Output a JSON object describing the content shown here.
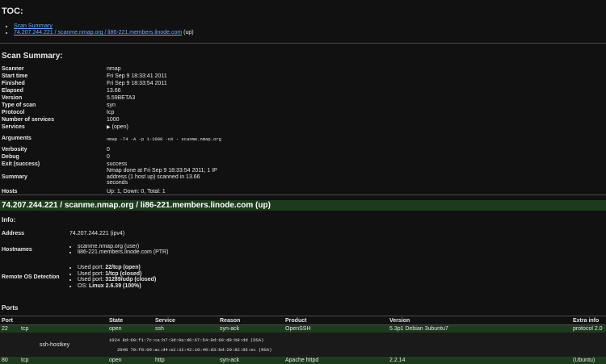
{
  "toc": {
    "title": "TOC:",
    "items": [
      {
        "link": "Scan Summary",
        "suffix": ""
      },
      {
        "link": "74.207.244.221 / scanme.nmap.org / li86-221.members.linode.com",
        "suffix": " (up)"
      }
    ]
  },
  "summary": {
    "title": "Scan Summary:",
    "rows": [
      {
        "label": "Scanner",
        "value": "nmap"
      },
      {
        "label": "Start time",
        "value": "Fri Sep 9 18:33:41 2011"
      },
      {
        "label": "Finished",
        "value": "Fri Sep 9 18:33:54 2011"
      },
      {
        "label": "Elapsed",
        "value": "13.66"
      },
      {
        "label": "Version",
        "value": "5.59BETA3"
      },
      {
        "label": "Type of scan",
        "value": "syn"
      },
      {
        "label": "Protocol",
        "value": "tcp"
      },
      {
        "label": "Number of services",
        "value": "1000"
      },
      {
        "label": "Services",
        "value": "(open)"
      },
      {
        "label": "Arguments",
        "value": "nmap -T4 -A -p 1-1000 -oX - scanme.nmap.org"
      },
      {
        "label": "Verbosity",
        "value": "0"
      },
      {
        "label": "Debug",
        "value": "0"
      },
      {
        "label": "Exit (success)",
        "value": "success"
      },
      {
        "label": "Summary",
        "value": "Nmap done at Fri Sep 9 18:33:54 2011; 1 IP address (1 host up) scanned in 13.66 seconds"
      },
      {
        "label": "Hosts",
        "value": "Up: 1, Down: 0, Total: 1"
      }
    ]
  },
  "host": {
    "heading": "74.207.244.221 / scanme.nmap.org / li86-221.members.linode.com (up)",
    "info_title": "Info:",
    "address_label": "Address",
    "address": "74.207.244.221 (ipv4)",
    "hostnames_label": "Hostnames",
    "hostnames": [
      "scanme.nmap.org (user)",
      "li86-221.members.linode.com (PTR)"
    ],
    "os_label": "Remote OS Detection",
    "os": [
      {
        "prefix": "Used port: ",
        "bold": "22/tcp (open)"
      },
      {
        "prefix": "Used port: ",
        "bold": "1/tcp (closed)"
      },
      {
        "prefix": "Used port: ",
        "bold": "31289/udp (closed)"
      },
      {
        "prefix": "OS: ",
        "bold": "Linux 2.6.39 (100%)"
      }
    ]
  },
  "ports": {
    "title": "Ports",
    "headers": [
      "Port",
      "",
      "State",
      "Service",
      "Reason",
      "Product",
      "Version",
      "Extra info"
    ],
    "rows": [
      {
        "port": "22",
        "proto": "tcp",
        "state": "open",
        "service": "ssh",
        "reason": "syn-ack",
        "product": "OpenSSH",
        "version": "5.3p1 Debian 3ubuntu7",
        "extra": "protocol 2.0"
      },
      {
        "port": "80",
        "proto": "tcp",
        "state": "open",
        "service": "http",
        "reason": "syn-ack",
        "product": "Apache httpd",
        "version": "2.2.14",
        "extra": "(Ubuntu)"
      }
    ],
    "script": {
      "name": "ssh-hostkey",
      "line1": "1024 8d:60:f1:7c:ca:b7:3d:0a:d6:67:54:9d:69:d9:b9:dd (DSA)",
      "line2": "2048 79:f8:09:ac:d4:e2:32:42:10:49:d3:bd:20:82:85:ec (RSA)"
    }
  }
}
